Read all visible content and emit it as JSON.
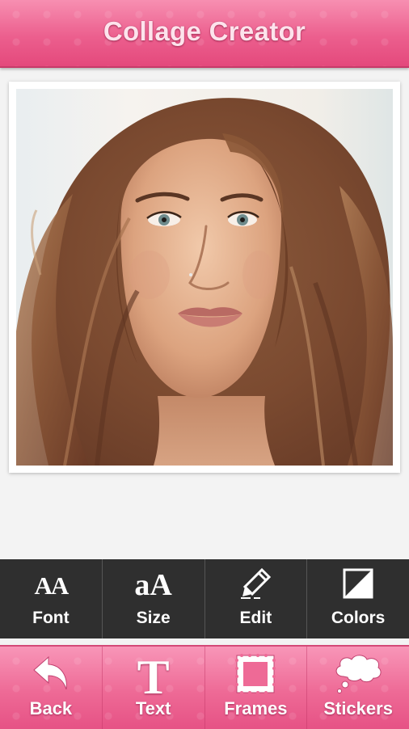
{
  "header": {
    "title": "Collage Creator"
  },
  "photo": {
    "icon": "portrait-photo",
    "description": "woman portrait"
  },
  "edit_toolbar": {
    "items": [
      {
        "label": "Font",
        "icon": "font-icon"
      },
      {
        "label": "Size",
        "icon": "text-size-icon"
      },
      {
        "label": "Edit",
        "icon": "pencil-icon"
      },
      {
        "label": "Colors",
        "icon": "contrast-icon"
      }
    ],
    "glyphs": {
      "font": "AA",
      "size": "aA"
    }
  },
  "bottom_nav": {
    "items": [
      {
        "label": "Back",
        "icon": "back-arrow-icon"
      },
      {
        "label": "Text",
        "icon": "text-t-icon",
        "glyph": "T"
      },
      {
        "label": "Frames",
        "icon": "frame-icon"
      },
      {
        "label": "Stickers",
        "icon": "speech-bubble-icon"
      }
    ]
  },
  "colors": {
    "header_pink": "#ec5f8e",
    "toolbar_dark": "#2f2f2f",
    "background": "#f3f3f3"
  }
}
